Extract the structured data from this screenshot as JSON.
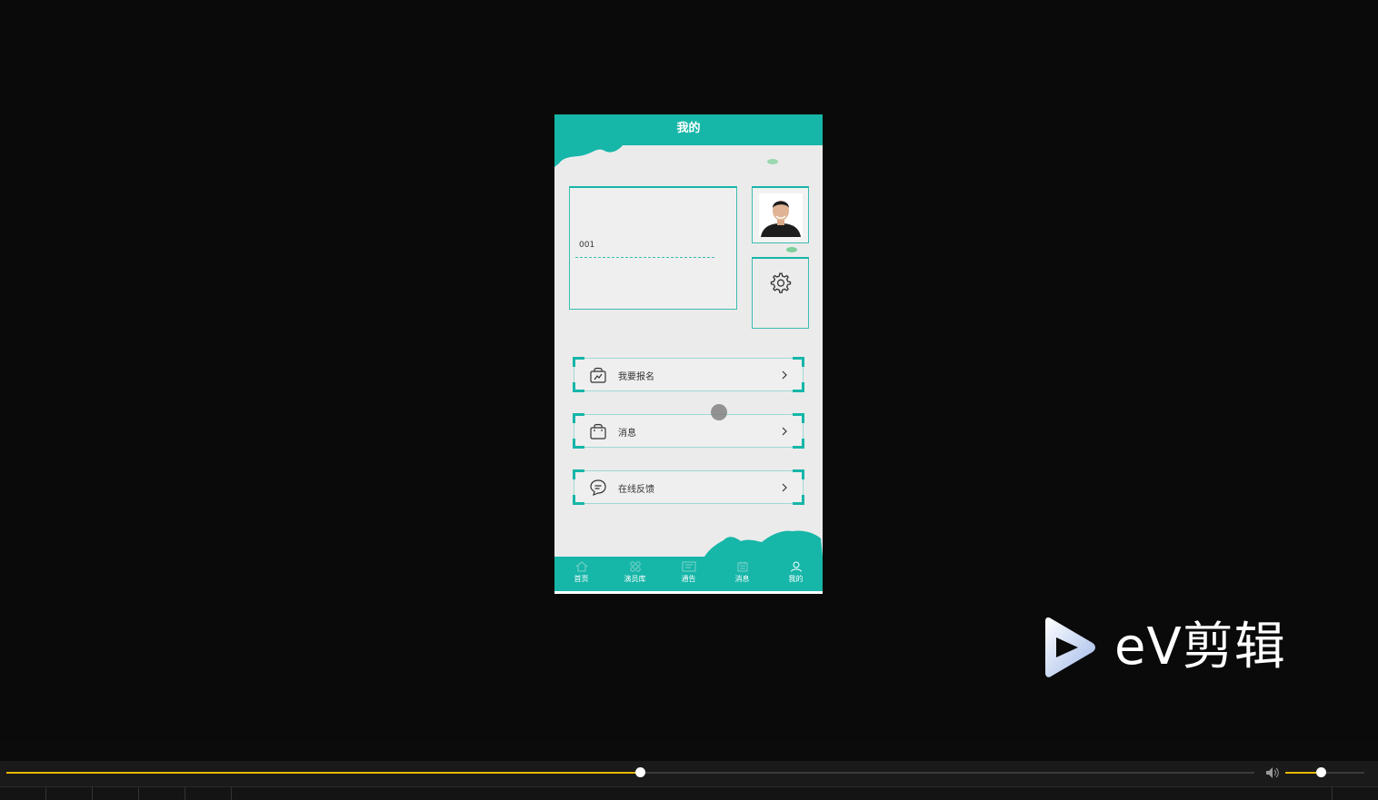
{
  "header": {
    "title": "我的"
  },
  "profile": {
    "user_id": "001"
  },
  "menu": [
    {
      "label": "我要报名",
      "icon": "bag-chart-icon"
    },
    {
      "label": "消息",
      "icon": "shopping-bag-icon"
    },
    {
      "label": "在线反馈",
      "icon": "chat-bubble-icon"
    }
  ],
  "tabbar": [
    {
      "label": "首页",
      "icon": "home-icon"
    },
    {
      "label": "演员库",
      "icon": "grid-icon"
    },
    {
      "label": "通告",
      "icon": "notice-icon"
    },
    {
      "label": "消息",
      "icon": "message-icon"
    },
    {
      "label": "我的",
      "icon": "user-icon"
    }
  ],
  "watermark": {
    "text": "eV剪辑"
  },
  "player": {
    "progress": 0.508,
    "volume": 0.45
  },
  "colors": {
    "accent": "#16b6a8",
    "border": "#3cbdb0",
    "progress": "#e6b800"
  }
}
